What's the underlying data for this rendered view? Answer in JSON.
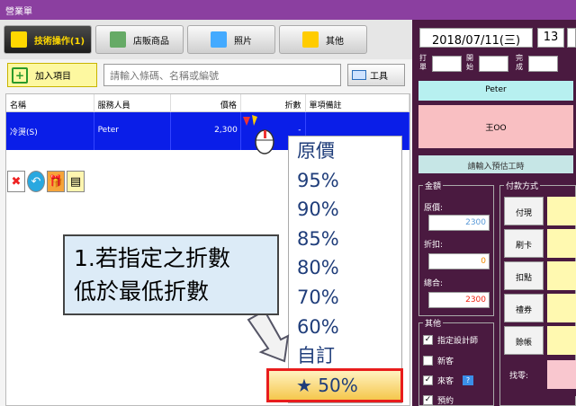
{
  "window": {
    "title": "營業單"
  },
  "tabs": [
    {
      "label": "技術操作(1)",
      "icon": "tech-icon",
      "color": "#333"
    },
    {
      "label": "店販商品",
      "icon": "shop-icon",
      "color": "#6a6"
    },
    {
      "label": "照片",
      "icon": "photo-icon",
      "color": "#4af"
    },
    {
      "label": "其他",
      "icon": "folder-icon",
      "color": "#fc0"
    }
  ],
  "toolbar": {
    "add_label": "加入項目",
    "search_placeholder": "請輸入條碼、名稱或編號",
    "tool_label": "工具"
  },
  "table": {
    "headers": [
      "名稱",
      "服務人員",
      "價格",
      "折數",
      "單項備註"
    ],
    "row": {
      "name": "冷燙(S)",
      "staff": "Peter",
      "price": "2,300",
      "discount": "-",
      "note": ""
    }
  },
  "dropdown": {
    "items": [
      "原價",
      "95%",
      "90%",
      "85%",
      "80%",
      "70%",
      "60%",
      "自訂"
    ],
    "highlighted": "★ 50%"
  },
  "callout": {
    "line1": "1.若指定之折數",
    "line2": "低於最低折數"
  },
  "right": {
    "date": "2018/07/11(三)",
    "hour": "13",
    "time_labels": {
      "clock_in": "打單",
      "start": "開始",
      "finish": "完成"
    },
    "staff": "Peter",
    "customer": "王OO",
    "estimate_label": "請輸入預估工時",
    "amount": {
      "legend": "金額",
      "original_label": "原價:",
      "original_value": "2300",
      "discount_label": "折扣:",
      "discount_value": "0",
      "total_label": "總合:",
      "total_value": "2300"
    },
    "payment": {
      "legend": "付款方式",
      "methods": [
        "付現",
        "刷卡",
        "扣點",
        "禮券",
        "賒帳"
      ],
      "find_zero_label": "找零:"
    },
    "other": {
      "legend": "其他",
      "checks": [
        {
          "label": "指定設計師",
          "checked": true
        },
        {
          "label": "新客",
          "checked": false
        },
        {
          "label": "來客",
          "checked": true
        },
        {
          "label": "預約",
          "checked": true
        }
      ]
    }
  }
}
